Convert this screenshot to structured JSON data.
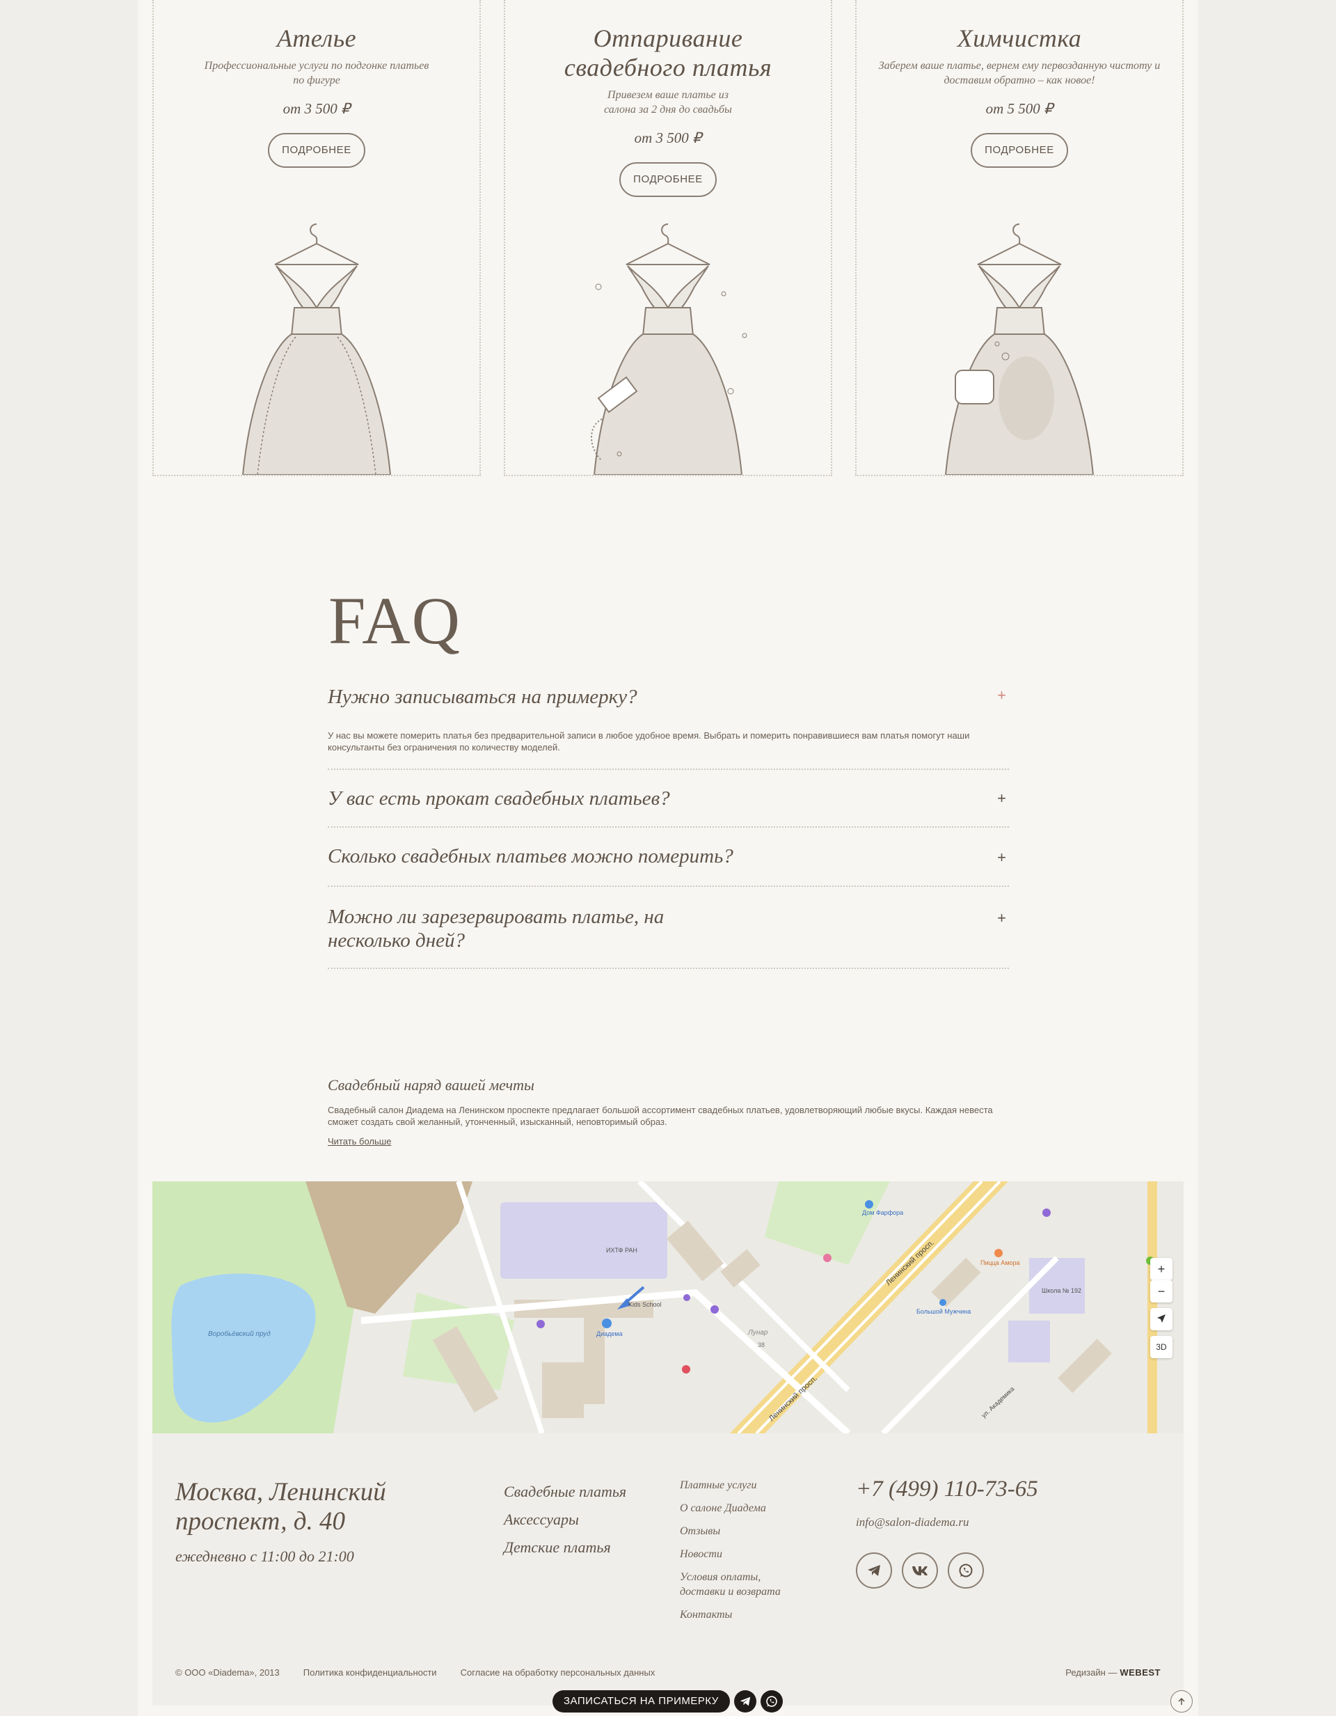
{
  "services": [
    {
      "title": "Ателье",
      "desc": "Профессиональные услуги по подгонке платьев по фигуре",
      "price": "от 3 500 ₽",
      "button": "ПОДРОБНЕЕ"
    },
    {
      "title": "Отпаривание свадебного платья",
      "desc": "Привезем ваше платье из салона за 2 дня до свадьбы",
      "price": "от 3 500 ₽",
      "button": "ПОДРОБНЕЕ"
    },
    {
      "title": "Химчистка",
      "desc": "Заберем ваше платье, вернем ему первозданную чистоту и доставим обратно – как новое!",
      "price": "от 5 500 ₽",
      "button": "ПОДРОБНЕЕ"
    }
  ],
  "faq": {
    "title": "FAQ",
    "items": [
      {
        "q": "Нужно записываться на примерку?",
        "a": "У нас вы можете померить платья без предварительной записи в любое удобное время. Выбрать и померить понравившиеся вам платья помогут наши консультанты без ограничения по количеству моделей.",
        "toggle": "+"
      },
      {
        "q": "У вас есть прокат свадебных платьев?",
        "toggle": "+"
      },
      {
        "q": "Сколько свадебных платьев можно померить?",
        "toggle": "+"
      },
      {
        "q": "Можно ли зарезервировать платье, на несколько дней?",
        "toggle": "+"
      }
    ]
  },
  "seo": {
    "title": "Свадебный наряд вашей мечты",
    "text": "Свадебный салон Диадема на Ленинском проспекте предлагает большой ассортимент свадебных платьев, удовлетворяющий любые вкусы. Каждая невеста сможет создать свой желанный, утонченный, изысканный, неповторимый образ.",
    "link": "Читать больше"
  },
  "map": {
    "labels": {
      "pond": "Воробьёвский пруд",
      "ran": "ИХТФ РАН",
      "school": "Kids School",
      "diadema": "Диадема",
      "leninsky": "Ленинский просп.",
      "leninsky2": "Ленинский просп.",
      "lunar": "Лунар",
      "dom_farfora": "Дом Фарфора",
      "pizza": "Пицца Амора",
      "school2": "Школа № 192",
      "shop": "Большой Мужчина",
      "vavilova": "ул. Академика",
      "house": "38"
    },
    "controls": {
      "zoom_in": "+",
      "zoom_out": "−",
      "mode": "3D"
    }
  },
  "footer": {
    "address_line1": "Москва, Ленинский",
    "address_line2": "проспект, д. 40",
    "hours": "ежедневно с 11:00 до 21:00",
    "nav_main": [
      "Свадебные платья",
      "Аксессуары",
      "Детские платья"
    ],
    "nav_secondary": [
      "Платные услуги",
      "О салоне Диадема",
      "Отзывы",
      "Новости",
      "Условия оплаты, доставки и возврата",
      "Контакты"
    ],
    "phone": "+7 (499) 110-73-65",
    "email": "info@salon-diadema.ru",
    "social": [
      "telegram-icon",
      "vk-icon",
      "whatsapp-icon"
    ],
    "copyright": "© ООО «Diadema», 2013",
    "privacy": "Политика конфиденциальности",
    "consent": "Согласие на обработку персональных данных",
    "credit_prefix": "Редизайн —",
    "credit_brand": "WEBEST"
  },
  "sticky": {
    "cta": "ЗАПИСАТЬСЯ НА ПРИМЕРКУ"
  },
  "colors": {
    "background": "#f0eeea",
    "page": "#f7f6f3",
    "text": "#5f5348",
    "accent_open": "#d4887a",
    "sticky_bg": "#1f1b18"
  }
}
